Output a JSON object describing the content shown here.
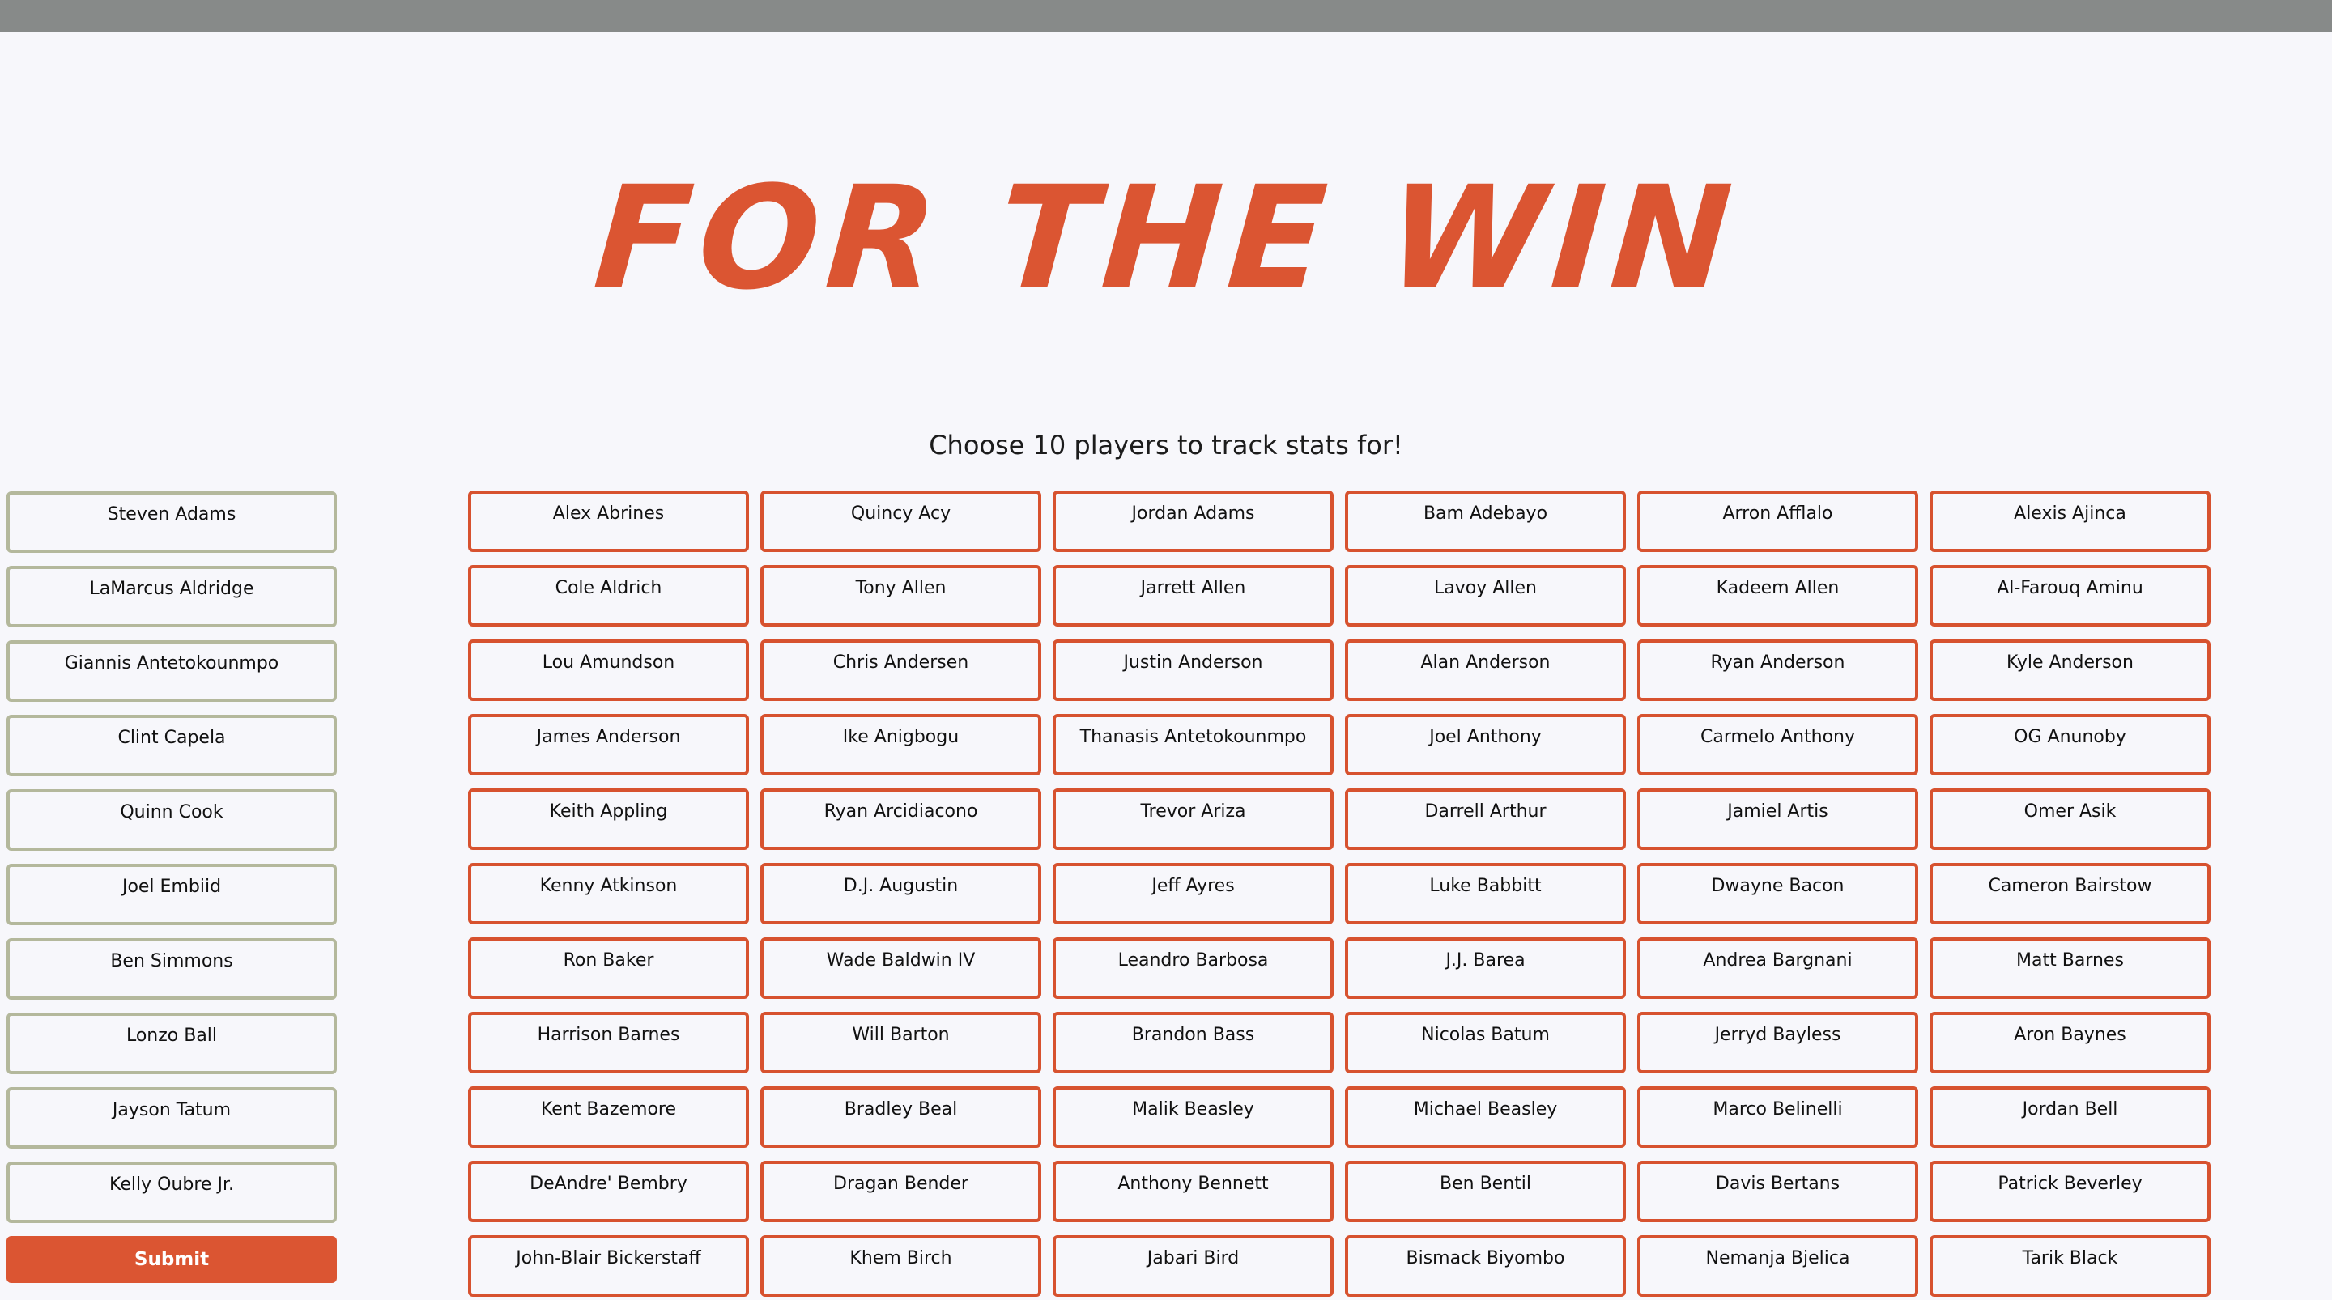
{
  "app": {
    "title": "FOR THE WIN",
    "instructions": "Choose 10 players to track stats for!"
  },
  "colors": {
    "accent": "#db5532",
    "selected_border": "#b4b89c",
    "background": "#f7f7fb",
    "topbar": "#878a89"
  },
  "selected_players": [
    "Steven Adams",
    "LaMarcus Aldridge",
    "Giannis Antetokounmpo",
    "Clint Capela",
    "Quinn Cook",
    "Joel Embiid",
    "Ben Simmons",
    "Lonzo Ball",
    "Jayson Tatum",
    "Kelly Oubre Jr."
  ],
  "submit_label": "Submit",
  "players": [
    "Alex Abrines",
    "Quincy Acy",
    "Jordan Adams",
    "Bam Adebayo",
    "Arron Afflalo",
    "Alexis Ajinca",
    "Cole Aldrich",
    "Tony Allen",
    "Jarrett Allen",
    "Lavoy Allen",
    "Kadeem Allen",
    "Al-Farouq Aminu",
    "Lou Amundson",
    "Chris Andersen",
    "Justin Anderson",
    "Alan Anderson",
    "Ryan Anderson",
    "Kyle Anderson",
    "James Anderson",
    "Ike Anigbogu",
    "Thanasis Antetokounmpo",
    "Joel Anthony",
    "Carmelo Anthony",
    "OG Anunoby",
    "Keith Appling",
    "Ryan Arcidiacono",
    "Trevor Ariza",
    "Darrell Arthur",
    "Jamiel Artis",
    "Omer Asik",
    "Kenny Atkinson",
    "D.J. Augustin",
    "Jeff Ayres",
    "Luke Babbitt",
    "Dwayne Bacon",
    "Cameron Bairstow",
    "Ron Baker",
    "Wade Baldwin IV",
    "Leandro Barbosa",
    "J.J. Barea",
    "Andrea Bargnani",
    "Matt Barnes",
    "Harrison Barnes",
    "Will Barton",
    "Brandon Bass",
    "Nicolas Batum",
    "Jerryd Bayless",
    "Aron Baynes",
    "Kent Bazemore",
    "Bradley Beal",
    "Malik Beasley",
    "Michael Beasley",
    "Marco Belinelli",
    "Jordan Bell",
    "DeAndre' Bembry",
    "Dragan Bender",
    "Anthony Bennett",
    "Ben Bentil",
    "Davis Bertans",
    "Patrick Beverley",
    "John-Blair Bickerstaff",
    "Khem Birch",
    "Jabari Bird",
    "Bismack Biyombo",
    "Nemanja Bjelica",
    "Tarik Black"
  ]
}
